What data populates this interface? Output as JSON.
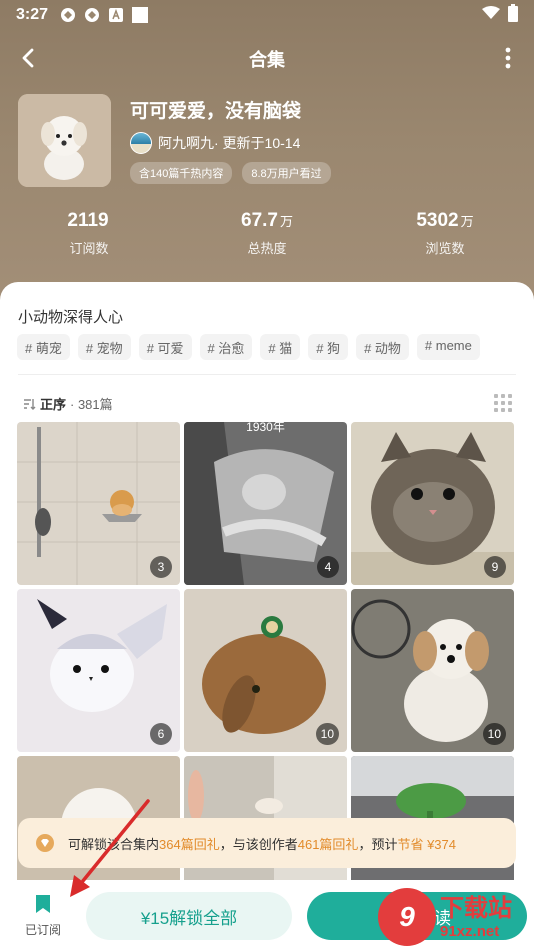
{
  "status": {
    "time": "3:27"
  },
  "nav": {
    "title": "合集"
  },
  "collection": {
    "title": "可可爱爱，没有脑袋",
    "author": "阿九啊九· 更新于10-14",
    "badges": [
      "含140篇千热内容",
      "8.8万用户看过"
    ]
  },
  "stats": [
    {
      "value": "2119",
      "unit": "",
      "label": "订阅数"
    },
    {
      "value": "67.7",
      "unit": "万",
      "label": "总热度"
    },
    {
      "value": "5302",
      "unit": "万",
      "label": "浏览数"
    }
  ],
  "description": "小动物深得人心",
  "tags": [
    "# 萌宠",
    "# 宠物",
    "# 可爱",
    "# 治愈",
    "# 猫",
    "# 狗",
    "# 动物",
    "# meme"
  ],
  "sort": {
    "label": "正序",
    "count": "· 381篇"
  },
  "grid": [
    {
      "count": "3",
      "caption": ""
    },
    {
      "count": "4",
      "caption": "1930年"
    },
    {
      "count": "9",
      "caption": ""
    },
    {
      "count": "6",
      "caption": ""
    },
    {
      "count": "10",
      "caption": ""
    },
    {
      "count": "10",
      "caption": ""
    },
    {
      "count": "",
      "caption": ""
    },
    {
      "count": "",
      "caption": ""
    },
    {
      "count": "",
      "caption": ""
    }
  ],
  "banner": {
    "part1": "可解锁该合集内",
    "num1": "364篇回礼",
    "part2": "，与该创作者",
    "num2": "461篇回礼",
    "part3": "，预计",
    "save": "节省 ¥374"
  },
  "bottom": {
    "subscribed": "已订阅",
    "unlock": "¥15解锁全部",
    "read": "开始阅读"
  },
  "watermark": {
    "big": "下载站",
    "small": "91xz.net",
    "logo": "9"
  }
}
